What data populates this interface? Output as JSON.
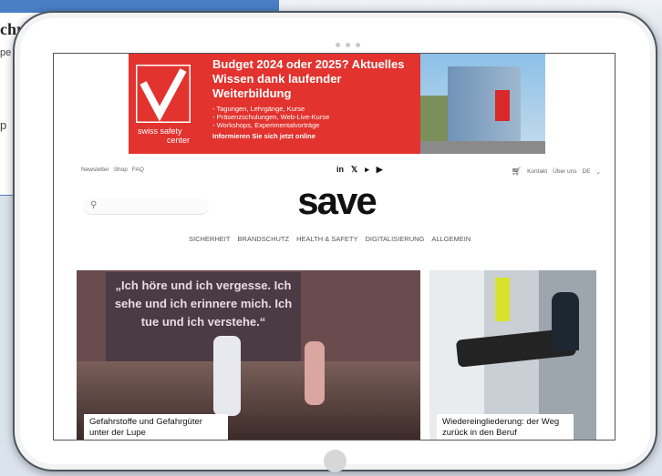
{
  "background": {
    "card_title": "chr",
    "card_snippet": "pe",
    "card_snippet2": "p"
  },
  "banner": {
    "logo_text_1": "swiss",
    "logo_text_2": "safety",
    "logo_text_3": "center",
    "headline": "Budget 2024 oder 2025? Aktuelles Wissen dank laufender Weiterbildung",
    "bullets": [
      "- Tagungen, Lehrgänge, Kurse",
      "- Präsenzschulungen, Web-Live-Kurse",
      "- Workshops, Experimentalvorträge"
    ],
    "cta": "Informieren Sie sich jetzt online"
  },
  "topbar": {
    "left_links": [
      "Newsletter",
      "Shop",
      "FAQ"
    ],
    "social": [
      "in",
      "𝕏",
      "▸",
      "▶"
    ],
    "right_links": [
      "Kontakt",
      "Über uns"
    ],
    "language": "DE",
    "icons": {
      "cart": "cart-icon",
      "chevron": "chevron-down-icon"
    }
  },
  "search": {
    "placeholder": ""
  },
  "logo": "save",
  "nav": [
    "SICHERHEIT",
    "BRANDSCHUTZ",
    "HEALTH & SAFETY",
    "DIGITALISIERUNG",
    "ALLGEMEIN"
  ],
  "articles": [
    {
      "slide_text": "„Ich höre und ich vergesse. Ich sehe und ich erinnere mich. Ich tue und ich verstehe.“",
      "title": "Gefahrstoffe und Gefahrgüter unter der Lupe"
    },
    {
      "title": "Wiedereingliederung: der Weg zurück in den Beruf"
    }
  ]
}
